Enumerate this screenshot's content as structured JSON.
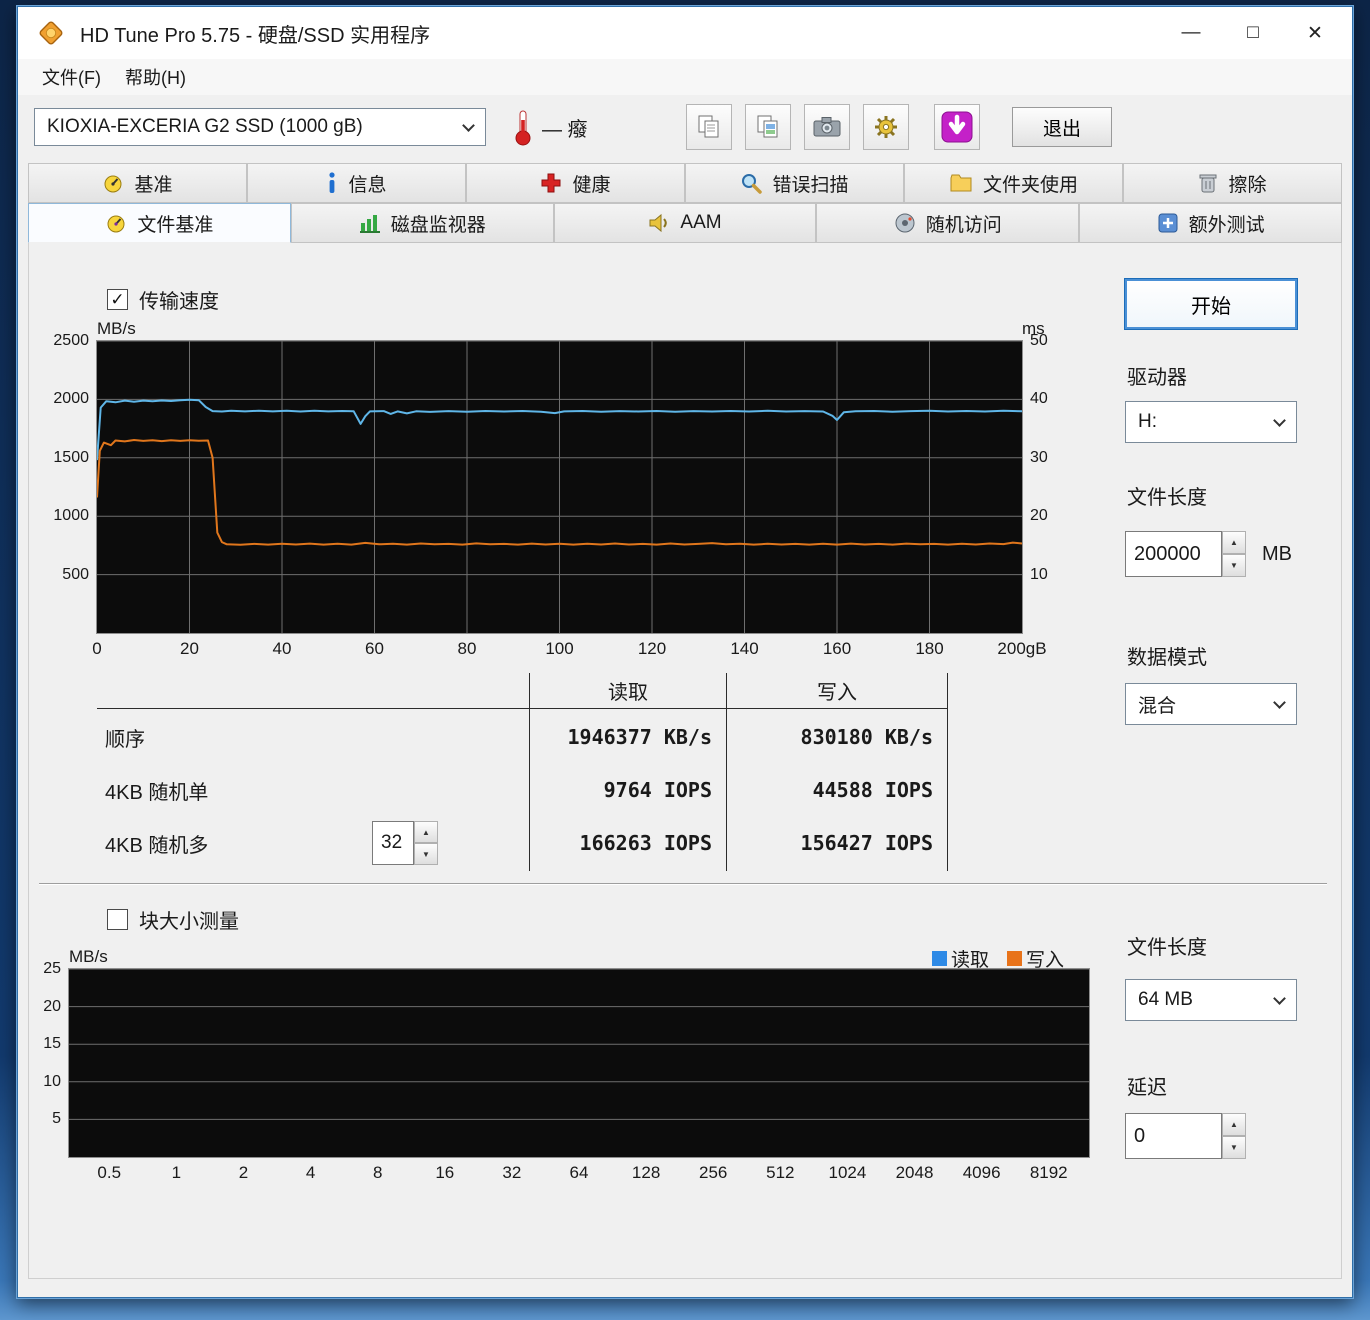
{
  "window": {
    "title": "HD Tune Pro 5.75 - 硬盘/SSD 实用程序",
    "minimize": "—",
    "maximize": "□",
    "close": "✕"
  },
  "menu": {
    "file": "文件(F)",
    "help": "帮助(H)"
  },
  "toolbar": {
    "drive_combo": "KIOXIA-EXCERIA G2 SSD (1000 gB)",
    "temperature": "— 癈",
    "exit_button": "退出"
  },
  "tabs": {
    "row1": [
      {
        "label": "基准"
      },
      {
        "label": "信息"
      },
      {
        "label": "健康"
      },
      {
        "label": "错误扫描"
      },
      {
        "label": "文件夹使用"
      },
      {
        "label": "擦除"
      }
    ],
    "row2": [
      {
        "label": "文件基准",
        "active": true
      },
      {
        "label": "磁盘监视器"
      },
      {
        "label": "AAM"
      },
      {
        "label": "随机访问"
      },
      {
        "label": "额外测试"
      }
    ]
  },
  "benchmark": {
    "transfer_speed_label": "传输速度",
    "transfer_speed_checked": true,
    "block_size_label": "块大小测量",
    "block_size_checked": false,
    "results": {
      "col_read": "读取",
      "col_write": "写入",
      "rows": [
        {
          "label": "顺序",
          "read": "1946377 KB/s",
          "write": "830180 KB/s"
        },
        {
          "label": "4KB 随机单",
          "read": "9764 IOPS",
          "write": "44588 IOPS"
        },
        {
          "label": "4KB 随机多",
          "spinner": "32",
          "read": "166263 IOPS",
          "write": "156427 IOPS"
        }
      ]
    }
  },
  "sidebar": {
    "start_button": "开始",
    "drive_label": "驱动器",
    "drive_value": "H:",
    "file_length_label": "文件长度",
    "file_length_value": "200000",
    "file_length_unit": "MB",
    "data_mode_label": "数据模式",
    "data_mode_value": "混合",
    "file_length2_label": "文件长度",
    "file_length2_value": "64 MB",
    "delay_label": "延迟",
    "delay_value": "0"
  },
  "chart_data": [
    {
      "type": "line",
      "title": "传输速度",
      "x_min": 0,
      "x_max": 200,
      "x_ticks": {
        "values": [
          0,
          20,
          40,
          60,
          80,
          100,
          120,
          140,
          160,
          180,
          200
        ],
        "labels": [
          "0",
          "20",
          "40",
          "60",
          "80",
          "100",
          "120",
          "140",
          "160",
          "180",
          "200gB"
        ]
      },
      "x_grid": [
        20,
        40,
        60,
        80,
        100,
        120,
        140,
        160,
        180
      ],
      "y_left": {
        "min": 0,
        "max": 2500,
        "ticks": [
          2500,
          2000,
          1500,
          1000,
          500
        ],
        "unit": "MB/s"
      },
      "y_right": {
        "min": 0,
        "max": 50,
        "ticks": [
          50,
          40,
          30,
          20,
          10
        ],
        "unit": "ms"
      },
      "bg": "#0c0c0c",
      "grid": "#6f6f6f",
      "series": [
        {
          "name": "读取",
          "color": "#5fb6e8",
          "points": [
            [
              0,
              1480
            ],
            [
              0.8,
              1930
            ],
            [
              2,
              1985
            ],
            [
              4,
              1975
            ],
            [
              6,
              1990
            ],
            [
              8,
              1980
            ],
            [
              10,
              1990
            ],
            [
              12,
              1985
            ],
            [
              14,
              1991
            ],
            [
              16,
              1986
            ],
            [
              18,
              1993
            ],
            [
              20,
              1997
            ],
            [
              22,
              1993
            ],
            [
              23.5,
              1935
            ],
            [
              25,
              1900
            ],
            [
              27,
              1896
            ],
            [
              29,
              1902
            ],
            [
              32,
              1897
            ],
            [
              35,
              1903
            ],
            [
              38,
              1897
            ],
            [
              41,
              1902
            ],
            [
              44,
              1896
            ],
            [
              47,
              1902
            ],
            [
              50,
              1897
            ],
            [
              53,
              1901
            ],
            [
              55.5,
              1898
            ],
            [
              57,
              1790
            ],
            [
              58,
              1856
            ],
            [
              59,
              1897
            ],
            [
              62,
              1900
            ],
            [
              63.5,
              1876
            ],
            [
              65,
              1897
            ],
            [
              67,
              1880
            ],
            [
              69,
              1898
            ],
            [
              72,
              1893
            ],
            [
              76,
              1900
            ],
            [
              80,
              1895
            ],
            [
              84,
              1901
            ],
            [
              88,
              1896
            ],
            [
              92,
              1901
            ],
            [
              96,
              1894
            ],
            [
              99,
              1883
            ],
            [
              101,
              1897
            ],
            [
              105,
              1901
            ],
            [
              109,
              1895
            ],
            [
              113,
              1900
            ],
            [
              117,
              1896
            ],
            [
              121,
              1901
            ],
            [
              125,
              1895
            ],
            [
              129,
              1900
            ],
            [
              133,
              1896
            ],
            [
              137,
              1901
            ],
            [
              141,
              1896
            ],
            [
              145,
              1902
            ],
            [
              149,
              1896
            ],
            [
              153,
              1900
            ],
            [
              157,
              1896
            ],
            [
              159,
              1860
            ],
            [
              160,
              1824
            ],
            [
              161.5,
              1890
            ],
            [
              164,
              1898
            ],
            [
              168,
              1901
            ],
            [
              172,
              1895
            ],
            [
              176,
              1900
            ],
            [
              180,
              1902
            ],
            [
              184,
              1896
            ],
            [
              188,
              1901
            ],
            [
              192,
              1896
            ],
            [
              196,
              1902
            ],
            [
              200,
              1898
            ]
          ]
        },
        {
          "name": "写入",
          "color": "#e0761c",
          "points": [
            [
              0,
              1160
            ],
            [
              0.6,
              1560
            ],
            [
              1.5,
              1630
            ],
            [
              3,
              1608
            ],
            [
              4,
              1648
            ],
            [
              6,
              1640
            ],
            [
              8,
              1652
            ],
            [
              10,
              1645
            ],
            [
              12,
              1650
            ],
            [
              14,
              1643
            ],
            [
              16,
              1651
            ],
            [
              18,
              1645
            ],
            [
              20,
              1650
            ],
            [
              22,
              1646
            ],
            [
              24,
              1648
            ],
            [
              25,
              1500
            ],
            [
              26,
              860
            ],
            [
              27,
              778
            ],
            [
              28,
              760
            ],
            [
              31,
              756
            ],
            [
              34,
              763
            ],
            [
              37,
              757
            ],
            [
              40,
              764
            ],
            [
              43,
              758
            ],
            [
              46,
              765
            ],
            [
              49,
              757
            ],
            [
              52,
              764
            ],
            [
              55,
              757
            ],
            [
              58,
              771
            ],
            [
              61,
              759
            ],
            [
              64,
              764
            ],
            [
              67,
              757
            ],
            [
              70,
              766
            ],
            [
              73,
              759
            ],
            [
              76,
              763
            ],
            [
              79,
              757
            ],
            [
              82,
              767
            ],
            [
              85,
              759
            ],
            [
              88,
              763
            ],
            [
              91,
              757
            ],
            [
              94,
              765
            ],
            [
              97,
              758
            ],
            [
              100,
              764
            ],
            [
              103,
              757
            ],
            [
              106,
              764
            ],
            [
              109,
              758
            ],
            [
              112,
              766
            ],
            [
              115,
              758
            ],
            [
              118,
              763
            ],
            [
              121,
              757
            ],
            [
              124,
              766
            ],
            [
              127,
              758
            ],
            [
              130,
              763
            ],
            [
              133,
              770
            ],
            [
              136,
              759
            ],
            [
              139,
              764
            ],
            [
              142,
              757
            ],
            [
              145,
              764
            ],
            [
              148,
              758
            ],
            [
              151,
              763
            ],
            [
              154,
              757
            ],
            [
              157,
              764
            ],
            [
              160,
              757
            ],
            [
              163,
              765
            ],
            [
              166,
              758
            ],
            [
              169,
              763
            ],
            [
              172,
              757
            ],
            [
              175,
              765
            ],
            [
              178,
              759
            ],
            [
              181,
              763
            ],
            [
              184,
              757
            ],
            [
              187,
              764
            ],
            [
              190,
              758
            ],
            [
              193,
              766
            ],
            [
              196,
              761
            ],
            [
              198,
              774
            ],
            [
              200,
              766
            ]
          ]
        }
      ]
    },
    {
      "type": "line",
      "title": "块大小测量",
      "x_min": -0.6,
      "x_max": 14.6,
      "x_ticks": {
        "values": [
          0,
          1,
          2,
          3,
          4,
          5,
          6,
          7,
          8,
          9,
          10,
          11,
          12,
          13,
          14
        ],
        "labels": [
          "0.5",
          "1",
          "2",
          "4",
          "8",
          "16",
          "32",
          "64",
          "128",
          "256",
          "512",
          "1024",
          "2048",
          "4096",
          "8192"
        ]
      },
      "x_grid": [],
      "y_left": {
        "min": 0,
        "max": 25,
        "ticks": [
          25,
          20,
          15,
          10,
          5
        ],
        "unit": "MB/s"
      },
      "bg": "#0c0c0c",
      "grid": "#6f6f6f",
      "series": [],
      "legend": {
        "position": "top-right",
        "items": [
          {
            "label": "读取",
            "color": "#2e8ae6"
          },
          {
            "label": "写入",
            "color": "#e8731a"
          }
        ]
      }
    }
  ]
}
